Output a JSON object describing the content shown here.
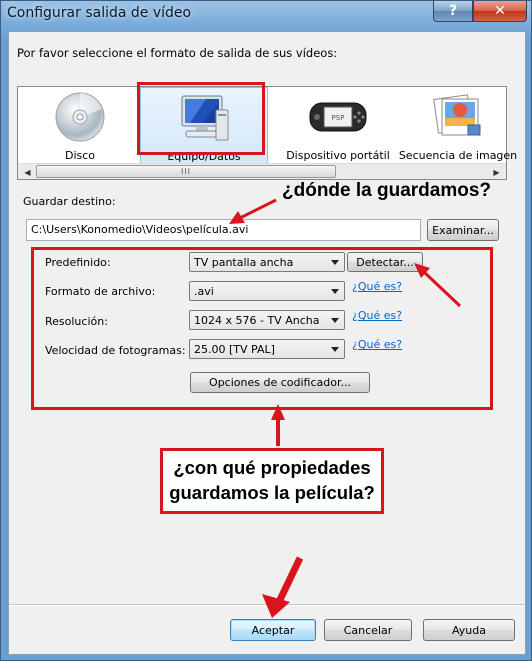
{
  "window": {
    "title": "Configurar salida de vídeo",
    "help_label": "?",
    "close_label": "✕"
  },
  "prompt": "Por favor seleccione el formato de salida de sus vídeos:",
  "devices": [
    {
      "label": "Disco",
      "icon": "disc-icon"
    },
    {
      "label": "Equipo/Datos",
      "icon": "computer-icon",
      "selected": true
    },
    {
      "label": "Dispositivo portátil",
      "icon": "psp-icon"
    },
    {
      "label": "Secuencia de imagen",
      "icon": "image-sequence-icon"
    }
  ],
  "destination": {
    "label": "Guardar destino:",
    "value": "C:\\Users\\Konomedio\\Videos\\película.avi",
    "browse_label": "Examinar..."
  },
  "properties": {
    "preset": {
      "label": "Predefinido:",
      "value": "TV pantalla ancha",
      "detect_label": "Detectar..."
    },
    "file_format": {
      "label": "Formato de archivo:",
      "value": ".avi",
      "help": "¿Qué es?"
    },
    "resolution": {
      "label": "Resolución:",
      "value": "1024 x 576 - TV Ancha",
      "help": "¿Qué es?"
    },
    "frame_rate": {
      "label": "Velocidad de fotogramas:",
      "value": "25.00 [TV PAL]",
      "help": "¿Qué es?"
    },
    "encoder_options_label": "Opciones de codificador..."
  },
  "annotations": {
    "where": "¿dónde la guardamos?",
    "how_line1": "¿con qué propiedades",
    "how_line2": "guardamos la película?"
  },
  "footer": {
    "ok_label": "Aceptar",
    "cancel_label": "Cancelar",
    "help_label": "Ayuda"
  },
  "scrollbar": {
    "grip": "III"
  },
  "colors": {
    "annotation_red": "#d8141c",
    "link": "#0066cc",
    "title_bar": "#74a7d6"
  }
}
